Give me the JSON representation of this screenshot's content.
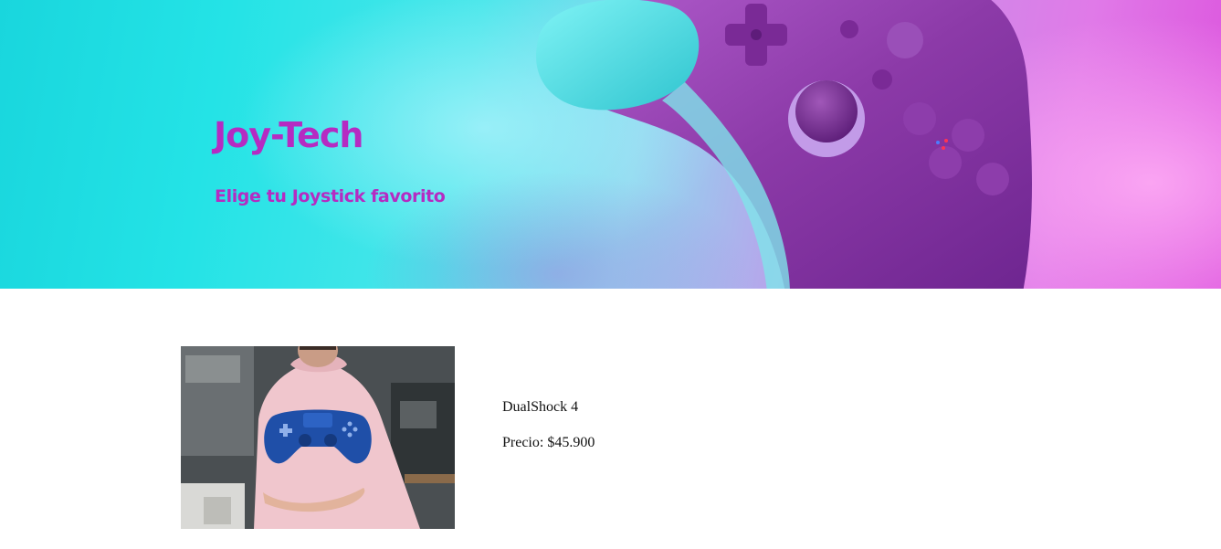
{
  "hero": {
    "title": "Joy-Tech",
    "subtitle": "Elige tu Joystick favorito",
    "image_subject": "purple-xbox-controller"
  },
  "products": [
    {
      "name": "DualShock 4",
      "price": "Precio: $45.900",
      "image_subject": "person-with-pink-hoodie-holding-blue-dualshock-controller"
    }
  ],
  "colors": {
    "title_magenta": "#b52bc2",
    "hero_cyan": "#24e3e6",
    "hero_pink": "#dc52dd",
    "controller_purple": "#8a3aa6",
    "dualshock_blue": "#1f4fa8"
  }
}
